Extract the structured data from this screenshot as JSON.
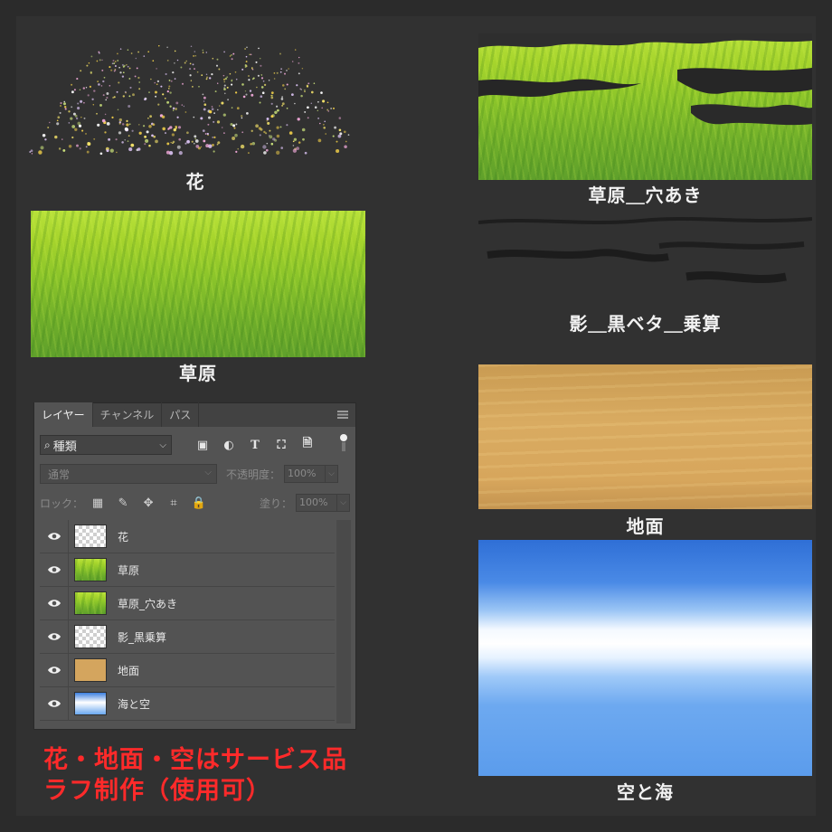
{
  "captions": {
    "flowers": "花",
    "grass": "草原",
    "grass_holes": "草原＿穴あき",
    "shadow": "影＿黒ベタ＿乗算",
    "ground": "地面",
    "sky": "空と海"
  },
  "panel": {
    "tabs": [
      "レイヤー",
      "チャンネル",
      "パス"
    ],
    "kind_filter": "種類",
    "blend_mode": "通常",
    "opacity_label": "不透明度：",
    "opacity_value": "100%",
    "lock_label": "ロック：",
    "fill_label": "塗り：",
    "fill_value": "100%",
    "filter_icons": [
      "image-filter-icon",
      "adjustment-filter-icon",
      "text-filter-icon",
      "shape-filter-icon",
      "smartobject-filter-icon"
    ],
    "lock_icons": [
      "lock-transparent-icon",
      "lock-paint-icon",
      "lock-move-icon",
      "lock-artboard-icon",
      "lock-all-icon"
    ],
    "layers": [
      {
        "name": "花",
        "thumb": "transparent"
      },
      {
        "name": "草原",
        "thumb": "grass"
      },
      {
        "name": "草原_穴あき",
        "thumb": "grass"
      },
      {
        "name": "影_黒乗算",
        "thumb": "transparent"
      },
      {
        "name": "地面",
        "thumb": "ground"
      },
      {
        "name": "海と空",
        "thumb": "sky"
      }
    ]
  },
  "note": {
    "line1": "花・地面・空はサービス品",
    "line2": "ラフ制作（使用可）"
  },
  "colors": {
    "background": "#2b2b2b",
    "panel": "#535353",
    "note": "#ff2a2a"
  }
}
